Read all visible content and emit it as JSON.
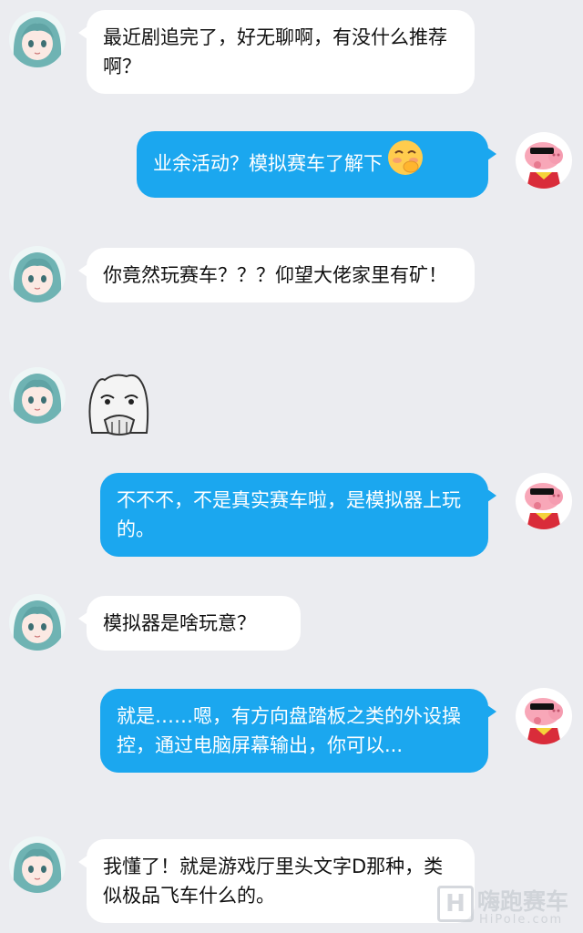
{
  "messages": [
    {
      "side": "left",
      "text": "最近剧追完了，好无聊啊，有没什么推荐啊？"
    },
    {
      "side": "right",
      "text": "业余活动？模拟赛车了解下",
      "trailing_emoji": "blushing-covering-mouth-emoji"
    },
    {
      "side": "left",
      "text": "你竟然玩赛车？？？仰望大佬家里有矿！"
    },
    {
      "side": "left",
      "sticker": "shocked-face-sticker"
    },
    {
      "side": "right",
      "text": "不不不，不是真实赛车啦，是模拟器上玩的。"
    },
    {
      "side": "left",
      "text": "模拟器是啥玩意？"
    },
    {
      "side": "right",
      "text": "就是……嗯，有方向盘踏板之类的外设操控，通过电脑屏幕输出，你可以..."
    },
    {
      "side": "left",
      "text": "我懂了！就是游戏厅里头文字D那种，类似极品飞车什么的。"
    }
  ],
  "avatars": {
    "left": "anime-girl-avatar",
    "right": "peppa-pig-sunglasses-avatar"
  },
  "watermark": {
    "title": "嗨跑赛车",
    "domain": "HiPole.com",
    "logo_letter": "H"
  },
  "colors": {
    "background": "#ebecf0",
    "incoming_bubble": "#ffffff",
    "outgoing_bubble": "#1ba7ef"
  }
}
